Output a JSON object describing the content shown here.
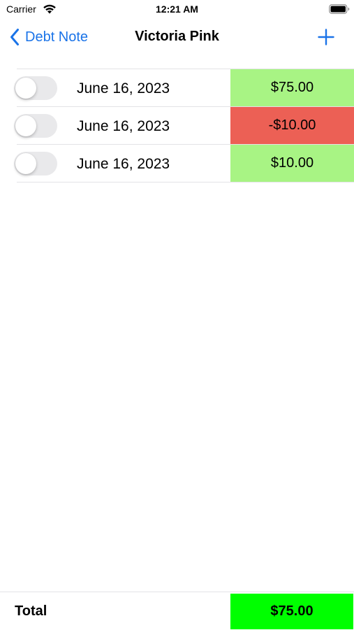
{
  "status_bar": {
    "carrier": "Carrier",
    "time": "12:21 AM",
    "wifi_icon": "wifi-icon",
    "battery_icon": "battery-icon"
  },
  "nav": {
    "back_label": "Debt Note",
    "title": "Victoria Pink",
    "back_icon": "chevron-left-icon",
    "add_icon": "plus-icon",
    "accent_color": "#1a73e8"
  },
  "entries": [
    {
      "date": "June 16, 2023",
      "amount": "$75.00",
      "toggle_on": false,
      "color": "#a8f484"
    },
    {
      "date": "June 16, 2023",
      "amount": "-$10.00",
      "toggle_on": false,
      "color": "#ec6055"
    },
    {
      "date": "June 16, 2023",
      "amount": "$10.00",
      "toggle_on": false,
      "color": "#a8f484"
    }
  ],
  "total": {
    "label": "Total",
    "value": "$75.00",
    "color": "#00ff00"
  }
}
